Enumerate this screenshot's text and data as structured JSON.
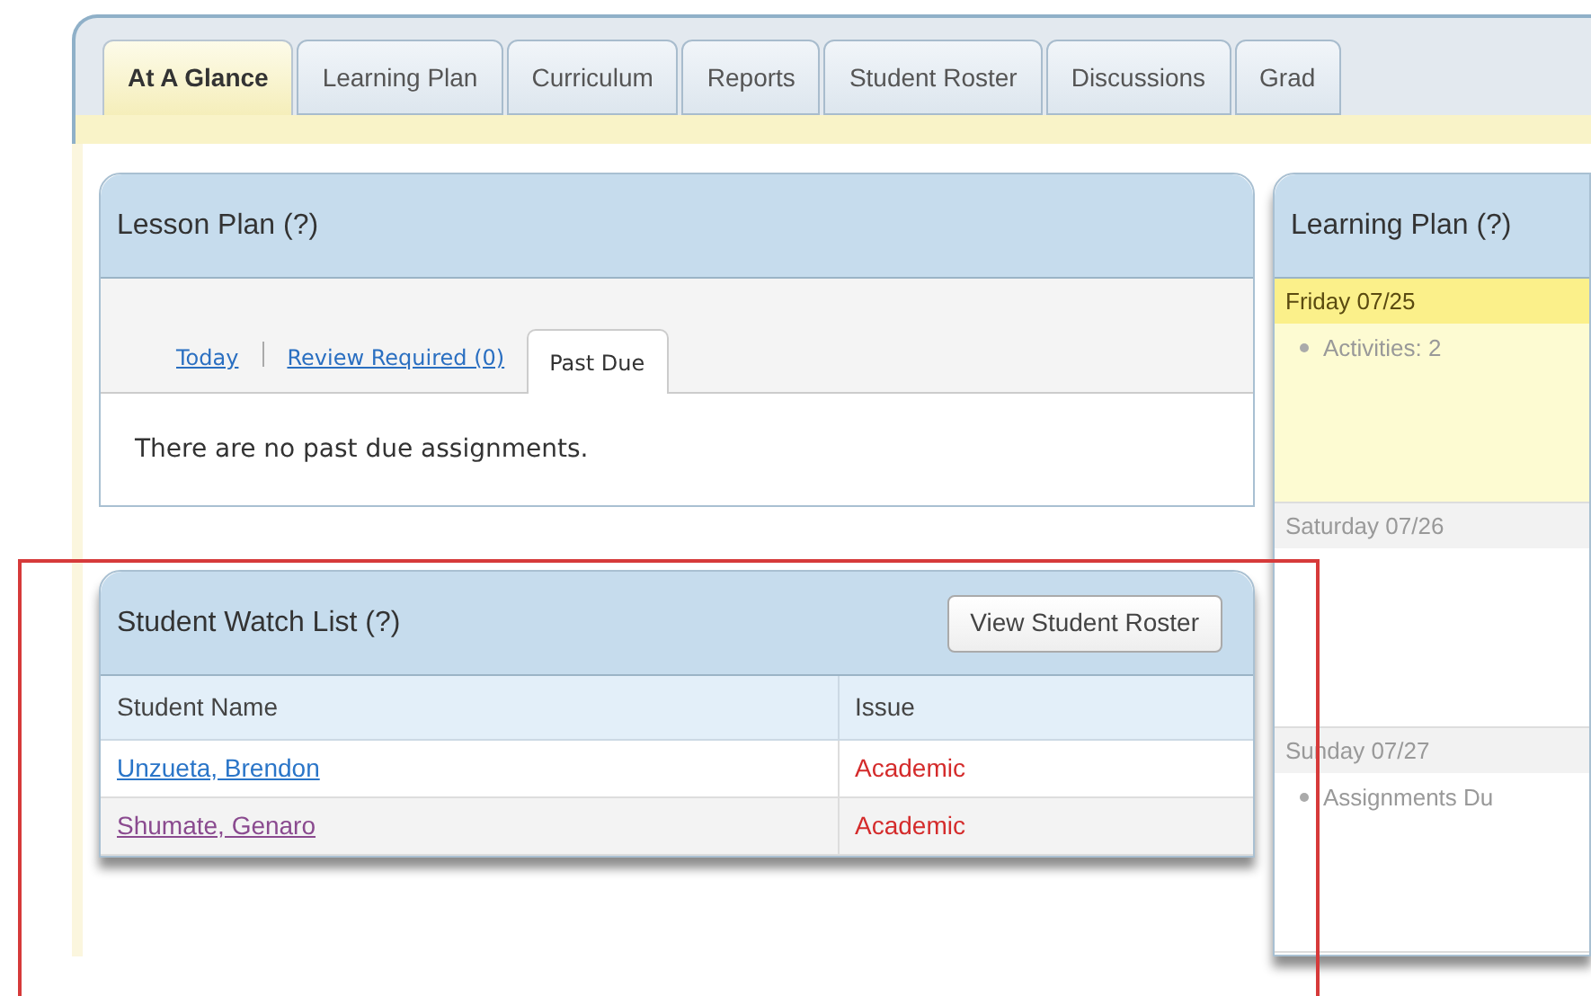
{
  "tabs": [
    {
      "label": "At A Glance",
      "selected": true
    },
    {
      "label": "Learning Plan",
      "selected": false
    },
    {
      "label": "Curriculum",
      "selected": false
    },
    {
      "label": "Reports",
      "selected": false
    },
    {
      "label": "Student Roster",
      "selected": false
    },
    {
      "label": "Discussions",
      "selected": false
    },
    {
      "label": "Grad",
      "selected": false
    }
  ],
  "lesson_plan": {
    "title": "Lesson Plan (?)",
    "subtabs": [
      {
        "label": "Today",
        "selected": false
      },
      {
        "label": "Review Required (0)",
        "selected": false
      },
      {
        "label": "Past Due",
        "selected": true
      }
    ],
    "message": "There are no past due assignments."
  },
  "watch_list": {
    "title": "Student Watch List (?)",
    "button": "View Student Roster",
    "columns": [
      "Student Name",
      "Issue"
    ],
    "rows": [
      {
        "name": "Unzueta, Brendon",
        "issue": "Academic",
        "visited": false
      },
      {
        "name": "Shumate, Genaro",
        "issue": "Academic",
        "visited": true
      }
    ]
  },
  "learning_plan": {
    "title": "Learning Plan (?)",
    "days": [
      {
        "label": "Friday 07/25",
        "highlighted": true,
        "items": [
          "Activities: 2"
        ]
      },
      {
        "label": "Saturday 07/26",
        "highlighted": false
      },
      {
        "label": "Sunday 07/27",
        "highlighted": false,
        "items": [
          "Assignments Du"
        ]
      }
    ]
  }
}
